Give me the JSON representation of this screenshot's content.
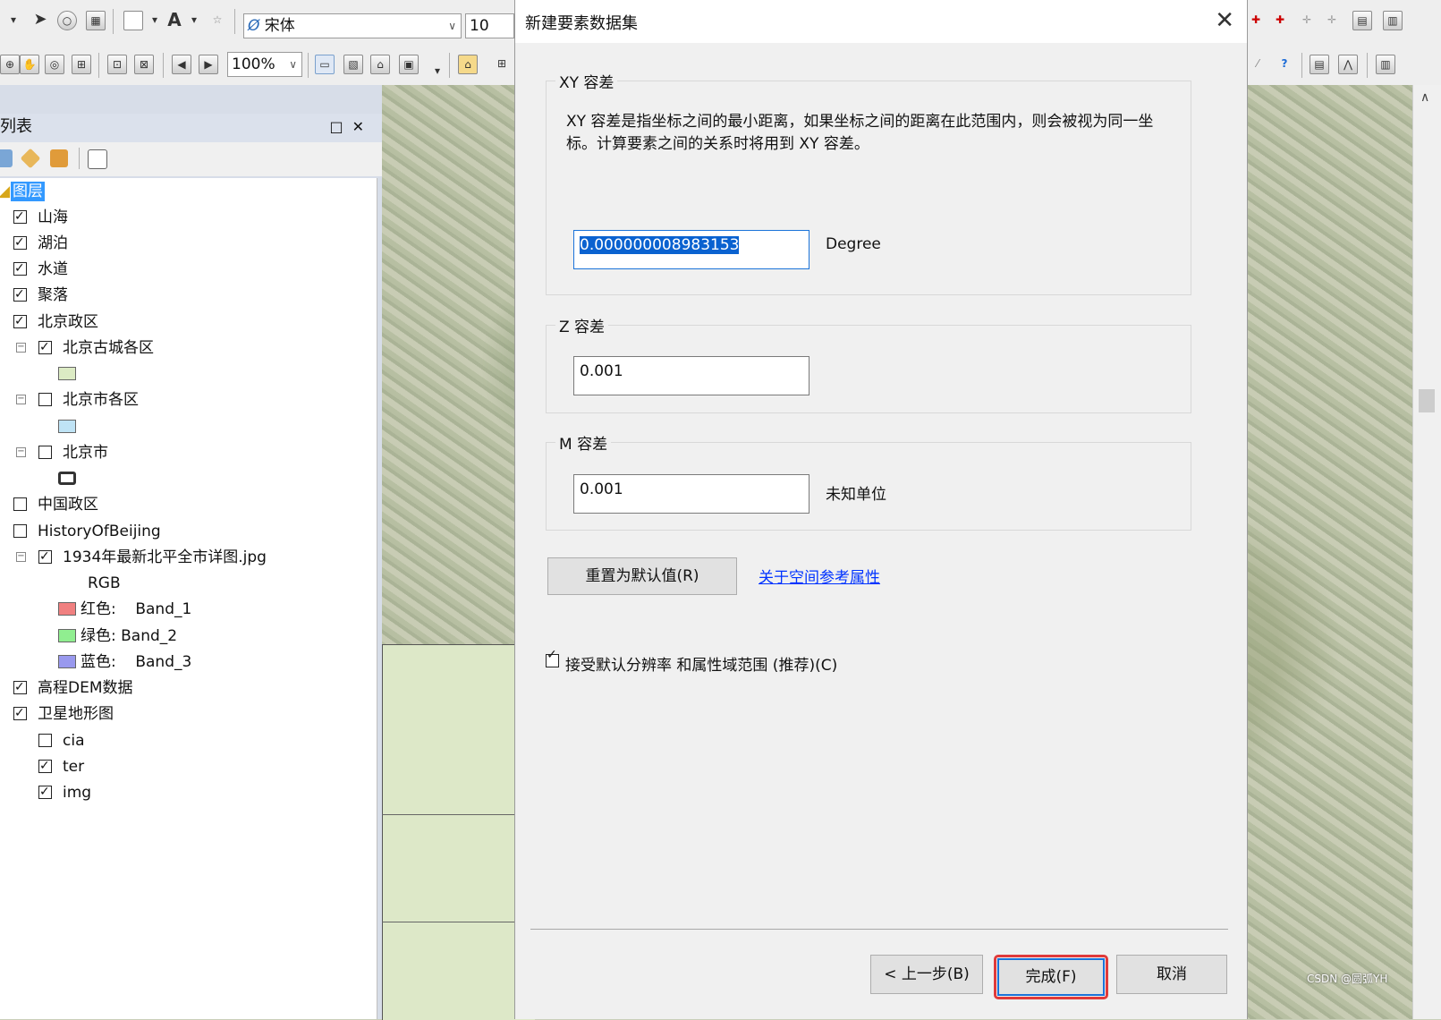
{
  "toolbar": {
    "font_name": "宋体",
    "font_size": "10",
    "zoom": "100%"
  },
  "toc": {
    "title": "列表",
    "root": "图层",
    "layers": [
      {
        "label": "山海",
        "checked": true
      },
      {
        "label": "湖泊",
        "checked": true
      },
      {
        "label": "水道",
        "checked": true
      },
      {
        "label": "聚落",
        "checked": true
      },
      {
        "label": "北京政区",
        "checked": true
      },
      {
        "label": "北京古城各区",
        "checked": true
      },
      {
        "label": "北京市各区",
        "checked": false
      },
      {
        "label": "北京市",
        "checked": false
      },
      {
        "label": "中国政区",
        "checked": false
      },
      {
        "label": "HistoryOfBeijing",
        "checked": false
      },
      {
        "label": "1934年最新北平全市详图.jpg",
        "checked": true
      },
      {
        "label": "RGB"
      },
      {
        "label": "红色:    Band_1",
        "color": "#f08080"
      },
      {
        "label": "绿色: Band_2",
        "color": "#90ee90"
      },
      {
        "label": "蓝色:    Band_3",
        "color": "#9999ee"
      },
      {
        "label": "高程DEM数据",
        "checked": true
      },
      {
        "label": "卫星地形图",
        "checked": true
      },
      {
        "label": "cia",
        "checked": false
      },
      {
        "label": "ter",
        "checked": true
      },
      {
        "label": "img",
        "checked": true
      }
    ],
    "swatches": {
      "guchengqu": "#dcebc4",
      "shigequ": "#bfe3f5"
    }
  },
  "dialog": {
    "title": "新建要素数据集",
    "xy_group": "XY 容差",
    "xy_desc_line1": "XY 容差是指坐标之间的最小距离，如果坐标之间的距离在此范围内，则会被视为同一坐",
    "xy_desc_line2": "标。计算要素之间的关系时将用到 XY 容差。",
    "xy_value": "0.000000008983153",
    "xy_unit": "Degree",
    "z_group": "Z 容差",
    "z_value": "0.001",
    "m_group": "M 容差",
    "m_value": "0.001",
    "m_unit": "未知单位",
    "reset_button": "重置为默认值(R)",
    "about_link": "关于空间参考属性",
    "accept_checkbox": "接受默认分辨率 和属性域范围 (推荐)(C)",
    "back_button": "< 上一步(B)",
    "finish_button": "完成(F)",
    "cancel_button": "取消"
  },
  "watermark": "CSDN @圆弧YH"
}
